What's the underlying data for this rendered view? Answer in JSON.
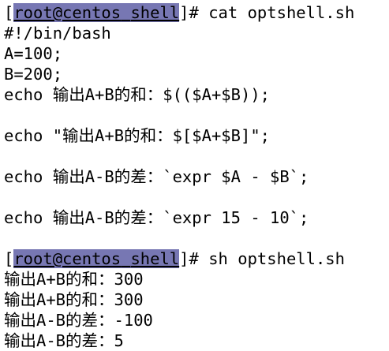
{
  "prompt": {
    "open": "[",
    "userhost": "root@centos",
    "space": " ",
    "dir": "shell",
    "close": "]# "
  },
  "commands": {
    "first": "cat optshell.sh",
    "second": "sh optshell.sh"
  },
  "script_lines": {
    "shebang": "#!/bin/bash",
    "assign_a": "A=100;",
    "assign_b": "B=200;",
    "echo_sum_paren": "echo 输出A+B的和：$(($A+$B));",
    "echo_sum_bracket": "echo \"输出A+B的和：$[$A+$B]\";",
    "echo_diff_vars": "echo 输出A-B的差：`expr $A - $B`;",
    "echo_diff_nums": "echo 输出A-B的差：`expr 15 - 10`;"
  },
  "output_lines": {
    "sum_1": "输出A+B的和：300",
    "sum_2": "输出A+B的和：300",
    "diff_1": "输出A-B的差：-100",
    "diff_2": "输出A-B的差：5"
  },
  "colors": {
    "background": "#ffffff",
    "text": "#000000",
    "prompt_highlight": "#7777b3"
  }
}
